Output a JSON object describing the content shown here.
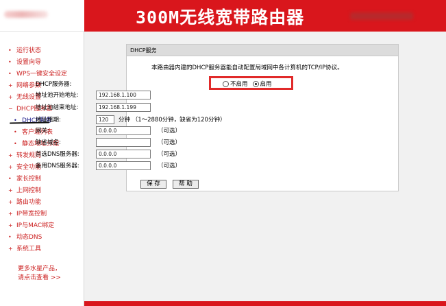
{
  "header": {
    "title": "300M无线宽带路由器"
  },
  "sidebar": {
    "items": [
      {
        "bullet": "•",
        "label": "运行状态",
        "sub": false
      },
      {
        "bullet": "•",
        "label": "设置向导",
        "sub": false
      },
      {
        "bullet": "•",
        "label": "WPS一键安全设定",
        "sub": false
      },
      {
        "bullet": "+",
        "label": "网络参数",
        "sub": false
      },
      {
        "bullet": "+",
        "label": "无线设置",
        "sub": false
      },
      {
        "bullet": "−",
        "label": "DHCP服务器",
        "sub": false
      },
      {
        "bullet": "•",
        "label": "DHCP服务",
        "sub": true,
        "active": true
      },
      {
        "bullet": "•",
        "label": "客户端列表",
        "sub": true
      },
      {
        "bullet": "•",
        "label": "静态地址分配",
        "sub": true
      },
      {
        "bullet": "+",
        "label": "转发规则",
        "sub": false
      },
      {
        "bullet": "+",
        "label": "安全功能",
        "sub": false
      },
      {
        "bullet": "•",
        "label": "家长控制",
        "sub": false
      },
      {
        "bullet": "+",
        "label": "上网控制",
        "sub": false
      },
      {
        "bullet": "+",
        "label": "路由功能",
        "sub": false
      },
      {
        "bullet": "+",
        "label": "IP带宽控制",
        "sub": false
      },
      {
        "bullet": "+",
        "label": "IP与MAC绑定",
        "sub": false
      },
      {
        "bullet": "•",
        "label": "动态DNS",
        "sub": false
      },
      {
        "bullet": "+",
        "label": "系统工具",
        "sub": false
      }
    ],
    "more_line1": "更多水星产品，",
    "more_line2": "请点击查看 >>"
  },
  "panel": {
    "title": "DHCP服务",
    "intro": "本路由器内建的DHCP服务器能自动配置局域网中各计算机的TCP/IP协议。",
    "dhcp_label": "DHCP服务器:",
    "option_disable": "不启用",
    "option_enable": "启用",
    "selected": "启用",
    "start_label": "地址池开始地址:",
    "start_value": "192.168.1.100",
    "end_label": "地址池结束地址:",
    "end_value": "192.168.1.199",
    "lease_label": "地址租期:",
    "lease_value": "120",
    "lease_note": "分钟 （1～2880分钟，缺省为120分钟）",
    "gateway_label": "网关:",
    "gateway_value": "0.0.0.0",
    "domain_label": "缺省域名:",
    "domain_value": "",
    "dns1_label": "首选DNS服务器:",
    "dns1_value": "0.0.0.0",
    "dns2_label": "备用DNS服务器:",
    "dns2_value": "0.0.0.0",
    "optional": "（可选）"
  },
  "buttons": {
    "save": "保 存",
    "help": "帮 助"
  },
  "colors": {
    "brand_red": "#d9161c",
    "nav_red": "#cc2222",
    "highlight_box": "#e12a2a"
  }
}
